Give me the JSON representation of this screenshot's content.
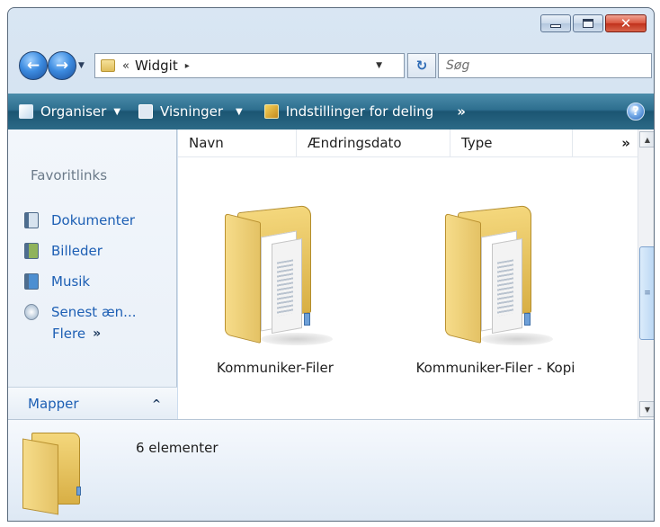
{
  "window": {
    "caption_close": "✕"
  },
  "address": {
    "overflow": "«",
    "crumb": "Widgit",
    "crumb_arrow": "▸",
    "refresh_glyph": "↻"
  },
  "search": {
    "placeholder": "Søg"
  },
  "toolbar": {
    "organise_label": "Organiser",
    "views_label": "Visninger",
    "share_label": "Indstillinger for deling",
    "more_label": "»",
    "help_label": "?"
  },
  "sidebar": {
    "header": "Favoritlinks",
    "items": [
      {
        "label": "Dokumenter",
        "icon": "documents-icon"
      },
      {
        "label": "Billeder",
        "icon": "pictures-icon"
      },
      {
        "label": "Musik",
        "icon": "music-icon"
      },
      {
        "label": "Senest æn...",
        "icon": "recent-icon"
      }
    ],
    "more_label": "Flere",
    "more_chevron": "»",
    "folders_label": "Mapper",
    "folders_chevron": "^"
  },
  "file_list": {
    "columns": [
      "Navn",
      "Ændringsdato",
      "Type",
      "»"
    ],
    "items": [
      {
        "name": "Kommuniker-Filer"
      },
      {
        "name": "Kommuniker-Filer - Kopi"
      }
    ]
  },
  "details": {
    "count_text": "6 elementer"
  },
  "colors": {
    "toolbar": "#1b5572",
    "link": "#1d5fb4",
    "folder": "#f4d77c"
  }
}
